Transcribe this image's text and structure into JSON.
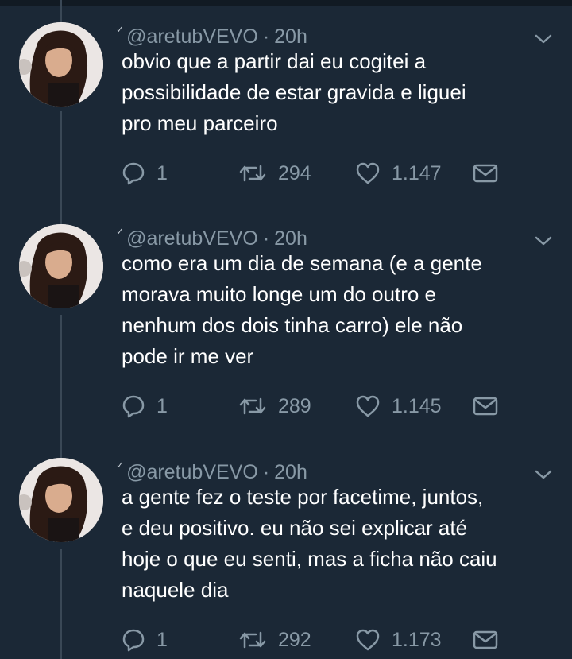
{
  "tweets": [
    {
      "author": "@aretubVEVO",
      "separator": "·",
      "time": "20h",
      "lines": [
        "obvio que a partir dai eu cogitei a",
        "possibilidade de estar gravida e liguei",
        "pro meu parceiro"
      ],
      "replies": "1",
      "retweets": "294",
      "likes": "1.147"
    },
    {
      "author": "@aretubVEVO",
      "separator": "·",
      "time": "20h",
      "lines": [
        "como era um dia de semana (e a gente",
        "morava muito longe um do outro e",
        "nenhum dos dois tinha carro) ele não",
        "pode ir me ver"
      ],
      "replies": "1",
      "retweets": "289",
      "likes": "1.145"
    },
    {
      "author": "@aretubVEVO",
      "separator": "·",
      "time": "20h",
      "lines": [
        "a gente fez o teste por facetime, juntos,",
        "e deu positivo. eu não sei explicar até",
        "hoje o que eu senti, mas a ficha não caiu",
        "naquele dia"
      ],
      "replies": "1",
      "retweets": "292",
      "likes": "1.173"
    }
  ],
  "icons": {
    "reply": "reply-icon",
    "retweet": "retweet-icon",
    "like": "heart-icon",
    "dm": "envelope-icon",
    "menu": "chevron-down-icon"
  },
  "colors": {
    "background": "#1b2836",
    "muted": "#8899a6",
    "text": "#ffffff"
  }
}
